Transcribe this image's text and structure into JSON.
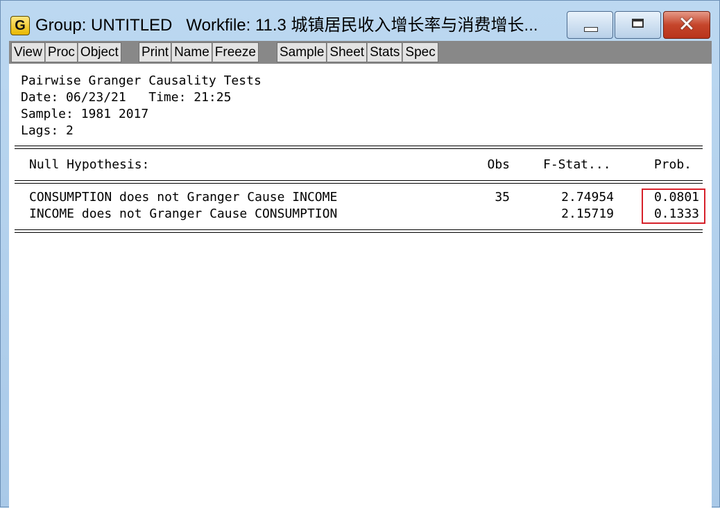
{
  "window": {
    "icon_letter": "G",
    "title": "Group: UNTITLED   Workfile: 11.3 城镇居民收入增长率与消费增长...",
    "controls": {
      "minimize": "minimize",
      "maximize": "maximize",
      "close": "close"
    }
  },
  "toolbar": {
    "group1": [
      "View",
      "Proc",
      "Object"
    ],
    "group2": [
      "Print",
      "Name",
      "Freeze"
    ],
    "group3": [
      "Sample",
      "Sheet",
      "Stats",
      "Spec"
    ]
  },
  "output": {
    "heading": "Pairwise Granger Causality Tests",
    "date_line": "Date: 06/23/21   Time: 21:25",
    "sample_line": "Sample: 1981 2017",
    "lags_line": "Lags: 2",
    "columns": {
      "hypothesis": "Null Hypothesis:",
      "obs": "Obs",
      "fstat": "F-Stat...",
      "prob": "Prob."
    },
    "rows": [
      {
        "hypothesis": "CONSUMPTION does not Granger Cause INCOME",
        "obs": "35",
        "fstat": "2.74954",
        "prob": "0.0801"
      },
      {
        "hypothesis": "INCOME does not Granger Cause CONSUMPTION",
        "obs": "",
        "fstat": "2.15719",
        "prob": "0.1333"
      }
    ]
  },
  "colors": {
    "highlight_box": "#d6202a",
    "toolbar_bg": "#888888",
    "titlebar_bg": "#bcd8f1"
  }
}
